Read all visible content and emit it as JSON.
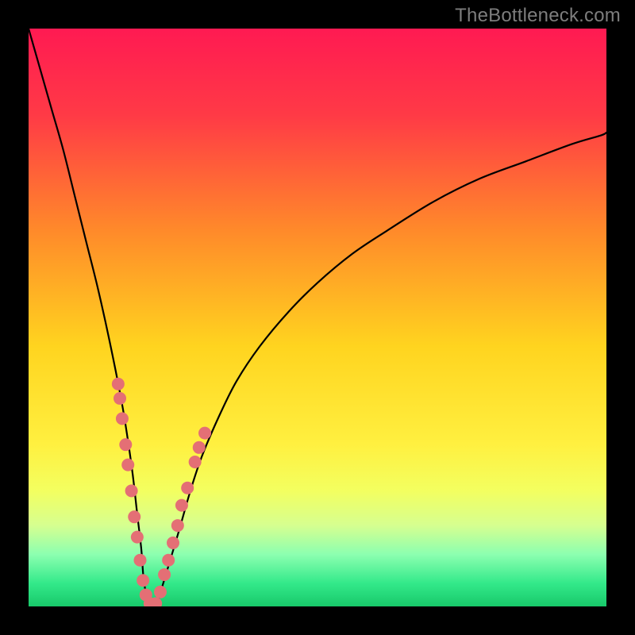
{
  "watermark": "TheBottleneck.com",
  "colors": {
    "bg": "#000000",
    "curve": "#000000",
    "marker": "#e46f75",
    "watermark": "#7d7d7d"
  },
  "chart_data": {
    "type": "line",
    "title": "",
    "xlabel": "",
    "ylabel": "",
    "xlim": [
      0,
      100
    ],
    "ylim": [
      0,
      100
    ],
    "grid": false,
    "gradient_stops": [
      {
        "offset": 0.0,
        "color": "#ff1a52"
      },
      {
        "offset": 0.15,
        "color": "#ff3a46"
      },
      {
        "offset": 0.35,
        "color": "#ff8a2a"
      },
      {
        "offset": 0.55,
        "color": "#ffd41f"
      },
      {
        "offset": 0.72,
        "color": "#fff040"
      },
      {
        "offset": 0.8,
        "color": "#f3ff60"
      },
      {
        "offset": 0.86,
        "color": "#d6ff90"
      },
      {
        "offset": 0.91,
        "color": "#8cffb0"
      },
      {
        "offset": 0.96,
        "color": "#33e98a"
      },
      {
        "offset": 1.0,
        "color": "#18c96a"
      }
    ],
    "series": [
      {
        "name": "curve",
        "x": [
          0,
          2,
          4,
          6,
          8,
          10,
          12,
          14,
          16,
          17,
          18,
          18.8,
          19.5,
          20,
          21,
          22,
          23,
          24.5,
          26,
          28,
          30,
          33,
          36,
          40,
          45,
          50,
          56,
          62,
          70,
          78,
          86,
          94,
          99,
          100
        ],
        "values": [
          100,
          93,
          86,
          79,
          71,
          63,
          55,
          46,
          36,
          30,
          23,
          16,
          10,
          4,
          0,
          0,
          3,
          8,
          13,
          20,
          26,
          33,
          39,
          45,
          51,
          56,
          61,
          65,
          70,
          74,
          77,
          80,
          81.5,
          82
        ]
      }
    ],
    "markers": [
      {
        "x": 15.5,
        "y": 38.5
      },
      {
        "x": 15.8,
        "y": 36.0
      },
      {
        "x": 16.2,
        "y": 32.5
      },
      {
        "x": 16.8,
        "y": 28.0
      },
      {
        "x": 17.2,
        "y": 24.5
      },
      {
        "x": 17.8,
        "y": 20.0
      },
      {
        "x": 18.3,
        "y": 15.5
      },
      {
        "x": 18.8,
        "y": 12.0
      },
      {
        "x": 19.3,
        "y": 8.0
      },
      {
        "x": 19.8,
        "y": 4.5
      },
      {
        "x": 20.3,
        "y": 2.0
      },
      {
        "x": 21.0,
        "y": 0.5
      },
      {
        "x": 22.0,
        "y": 0.5
      },
      {
        "x": 22.8,
        "y": 2.5
      },
      {
        "x": 23.5,
        "y": 5.5
      },
      {
        "x": 24.2,
        "y": 8.0
      },
      {
        "x": 25.0,
        "y": 11.0
      },
      {
        "x": 25.8,
        "y": 14.0
      },
      {
        "x": 26.5,
        "y": 17.5
      },
      {
        "x": 27.5,
        "y": 20.5
      },
      {
        "x": 28.8,
        "y": 25.0
      },
      {
        "x": 29.5,
        "y": 27.5
      },
      {
        "x": 30.5,
        "y": 30.0
      }
    ],
    "marker_radius": 8
  }
}
